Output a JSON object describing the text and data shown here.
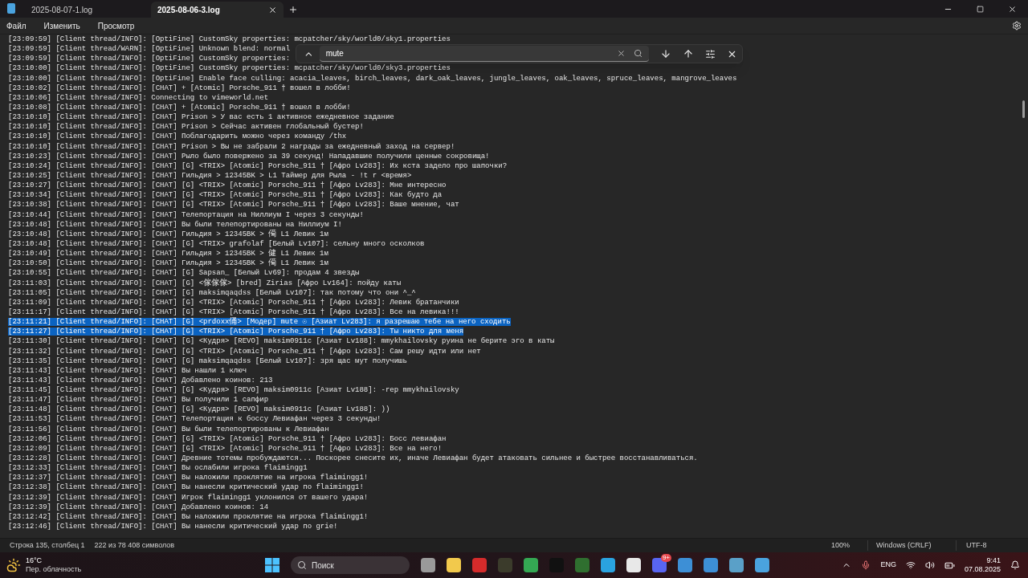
{
  "tabs": [
    {
      "label": "2025-08-07-1.log",
      "selected": false
    },
    {
      "label": "2025-08-06-3.log",
      "selected": true
    }
  ],
  "menu": [
    "Файл",
    "Изменить",
    "Просмотр"
  ],
  "find": {
    "value": "mute"
  },
  "lines": [
    {
      "text": "[23:09:59] [Client thread/INFO]: [OptiFine] CustomSky properties: mcpatcher/sky/world0/sky1.properties",
      "selected": false
    },
    {
      "text": "[23:09:59] [Client thread/WARN]: [OptiFine] Unknown blend: normal",
      "selected": false
    },
    {
      "text": "[23:09:59] [Client thread/INFO]: [OptiFine] CustomSky properties:",
      "selected": false
    },
    {
      "text": "[23:10:00] [Client thread/INFO]: [OptiFine] CustomSky properties: mcpatcher/sky/world0/sky3.properties",
      "selected": false
    },
    {
      "text": "[23:10:00] [Client thread/INFO]: [OptiFine] Enable face culling: acacia_leaves, birch_leaves, dark_oak_leaves, jungle_leaves, oak_leaves, spruce_leaves, mangrove_leaves",
      "selected": false
    },
    {
      "text": "[23:10:02] [Client thread/INFO]: [CHAT] + [Atomic] Porsche_911 † вошел в лобби!",
      "selected": false
    },
    {
      "text": "[23:10:06] [Client thread/INFO]: Connecting to vimeworld.net",
      "selected": false
    },
    {
      "text": "[23:10:08] [Client thread/INFO]: [CHAT] + [Atomic] Porsche_911 † вошел в лобби!",
      "selected": false
    },
    {
      "text": "[23:10:10] [Client thread/INFO]: [CHAT] Prison > У вас есть 1 активное ежедневное задание",
      "selected": false
    },
    {
      "text": "[23:10:10] [Client thread/INFO]: [CHAT] Prison > Сейчас активен глобальный бустер!",
      "selected": false
    },
    {
      "text": "[23:10:10] [Client thread/INFO]: [CHAT] Поблагодарить можно через команду /thx",
      "selected": false
    },
    {
      "text": "[23:10:10] [Client thread/INFO]: [CHAT] Prison > Вы не забрали 2 награды за ежедневный заход на сервер!",
      "selected": false
    },
    {
      "text": "[23:10:23] [Client thread/INFO]: [CHAT] Рыло было повержено за 39 секунд! Нападавшие получили ценные сокровища!",
      "selected": false
    },
    {
      "text": "[23:10:24] [Client thread/INFO]: [CHAT] [G] <TRIX> [Atomic] Porsche_911 † [Афро Lv283]: Их кста задело про шапочки?",
      "selected": false
    },
    {
      "text": "[23:10:25] [Client thread/INFO]: [CHAT] Гильдия > 12345BK > L1 Таймер для Рыла - !t r <время>",
      "selected": false
    },
    {
      "text": "[23:10:27] [Client thread/INFO]: [CHAT] [G] <TRIX> [Atomic] Porsche_911 † [Афро Lv283]: Мне интересно",
      "selected": false
    },
    {
      "text": "[23:10:34] [Client thread/INFO]: [CHAT] [G] <TRIX> [Atomic] Porsche_911 † [Афро Lv283]: Как будто да",
      "selected": false
    },
    {
      "text": "[23:10:38] [Client thread/INFO]: [CHAT] [G] <TRIX> [Atomic] Porsche_911 † [Афро Lv283]: Ваше мнение, чат",
      "selected": false
    },
    {
      "text": "[23:10:44] [Client thread/INFO]: [CHAT] Телепортация на Ниллиум I через 3 секунды!",
      "selected": false
    },
    {
      "text": "[23:10:48] [Client thread/INFO]: [CHAT] Вы были телепортированы на Ниллиум I!",
      "selected": false
    },
    {
      "text": "[23:10:48] [Client thread/INFO]: [CHAT] Гильдия > 12345BK > 僃 L1 Левик 1м",
      "selected": false
    },
    {
      "text": "[23:10:48] [Client thread/INFO]: [CHAT] [G] <TRIX> grafolaf [Белый Lv107]: сельну много осколков",
      "selected": false
    },
    {
      "text": "[23:10:49] [Client thread/INFO]: [CHAT] Гильдия > 12345BK > 健 L1 Левик 1м",
      "selected": false
    },
    {
      "text": "[23:10:50] [Client thread/INFO]: [CHAT] Гильдия > 12345BK > 僃 L1 Левик 1м",
      "selected": false
    },
    {
      "text": "[23:10:55] [Client thread/INFO]: [CHAT] [G] Sapsan_ [Белый Lv69]: продам 4 звезды",
      "selected": false
    },
    {
      "text": "[23:11:03] [Client thread/INFO]: [CHAT] [G] <傢傢傢> [bred] Zirias [Афро Lv164]: пойду каты",
      "selected": false
    },
    {
      "text": "[23:11:05] [Client thread/INFO]: [CHAT] [G] maksimqaqdss [Белый Lv107]: так потому что они ^_^",
      "selected": false
    },
    {
      "text": "[23:11:09] [Client thread/INFO]: [CHAT] [G] <TRIX> [Atomic] Porsche_911 † [Афро Lv283]: Левик братанчики",
      "selected": false
    },
    {
      "text": "[23:11:17] [Client thread/INFO]: [CHAT] [G] <TRIX> [Atomic] Porsche_911 † [Афро Lv283]: Все на левика!!!",
      "selected": false
    },
    {
      "text": "[23:11:21] [Client thread/INFO]: [CHAT] [G] <prdoxx俑> [Модер] mute ☉ [Азиат Lv283]: я разрешаю тебе на него сходить",
      "selected": true
    },
    {
      "text": "[23:11:27] [Client thread/INFO]: [CHAT] [G] <TRIX> [Atomic] Porsche_911 † [Афро Lv283]: Ты никто для меня",
      "selected": true
    },
    {
      "text": "[23:11:30] [Client thread/INFO]: [CHAT] [G] <Кудря> [REVO] maksim0911c [Азиат Lv188]: mmykhailovsky руина не берите эго в каты",
      "selected": false
    },
    {
      "text": "[23:11:32] [Client thread/INFO]: [CHAT] [G] <TRIX> [Atomic] Porsche_911 † [Афро Lv283]: Сам решу идти или нет",
      "selected": false
    },
    {
      "text": "[23:11:35] [Client thread/INFO]: [CHAT] [G] maksimqaqdss [Белый Lv107]: зря щас мут получишь",
      "selected": false
    },
    {
      "text": "[23:11:43] [Client thread/INFO]: [CHAT] Вы нашли 1 ключ",
      "selected": false
    },
    {
      "text": "[23:11:43] [Client thread/INFO]: [CHAT] Добавлено коинов: 213",
      "selected": false
    },
    {
      "text": "[23:11:45] [Client thread/INFO]: [CHAT] [G] <Кудря> [REVO] maksim0911c [Азиат Lv188]: -rep mmykhailovsky",
      "selected": false
    },
    {
      "text": "[23:11:47] [Client thread/INFO]: [CHAT] Вы получили 1 сапфир",
      "selected": false
    },
    {
      "text": "[23:11:48] [Client thread/INFO]: [CHAT] [G] <Кудря> [REVO] maksim0911c [Азиат Lv188]: ))",
      "selected": false
    },
    {
      "text": "[23:11:53] [Client thread/INFO]: [CHAT] Телепортация к боссу Левиафан через 3 секунды!",
      "selected": false
    },
    {
      "text": "[23:11:56] [Client thread/INFO]: [CHAT] Вы были телепортированы к Левиафан",
      "selected": false
    },
    {
      "text": "[23:12:06] [Client thread/INFO]: [CHAT] [G] <TRIX> [Atomic] Porsche_911 † [Афро Lv283]: Босс левиафан",
      "selected": false
    },
    {
      "text": "[23:12:09] [Client thread/INFO]: [CHAT] [G] <TRIX> [Atomic] Porsche_911 † [Афро Lv283]: Все на него!",
      "selected": false
    },
    {
      "text": "[23:12:28] [Client thread/INFO]: [CHAT] Древние тотемы пробуждаются... Поскорее снесите их, иначе Левиафан будет атаковать сильнее и быстрее восстанавливаться.",
      "selected": false
    },
    {
      "text": "[23:12:33] [Client thread/INFO]: [CHAT] Вы ослабили игрока flaimingg1",
      "selected": false
    },
    {
      "text": "[23:12:37] [Client thread/INFO]: [CHAT] Вы наложили проклятие на игрока flaimingg1!",
      "selected": false
    },
    {
      "text": "[23:12:38] [Client thread/INFO]: [CHAT] Вы нанесли критический удар по flaimingg1!",
      "selected": false
    },
    {
      "text": "[23:12:39] [Client thread/INFO]: [CHAT] Игрок flaimingg1 уклонился от вашего удара!",
      "selected": false
    },
    {
      "text": "[23:12:39] [Client thread/INFO]: [CHAT] Добавлено коинов: 14",
      "selected": false
    },
    {
      "text": "[23:12:42] [Client thread/INFO]: [CHAT] Вы наложили проклятие на игрока flaimingg1!",
      "selected": false
    },
    {
      "text": "[23:12:46] [Client thread/INFO]: [CHAT] Вы нанесли критический удар по grie!",
      "selected": false
    }
  ],
  "status_bar": {
    "position": "Строка 135, столбец 1",
    "selection": "222 из 78 408 символов",
    "zoom": "100%",
    "line_ending": "Windows (CRLF)",
    "encoding": "UTF-8"
  },
  "taskbar": {
    "weather": {
      "temperature": "16°C",
      "condition": "Пер. облачность"
    },
    "search": {
      "placeholder": "Поиск"
    },
    "badge": "9+",
    "language": "ENG",
    "time": "9:41",
    "date": "07.08.2025"
  }
}
